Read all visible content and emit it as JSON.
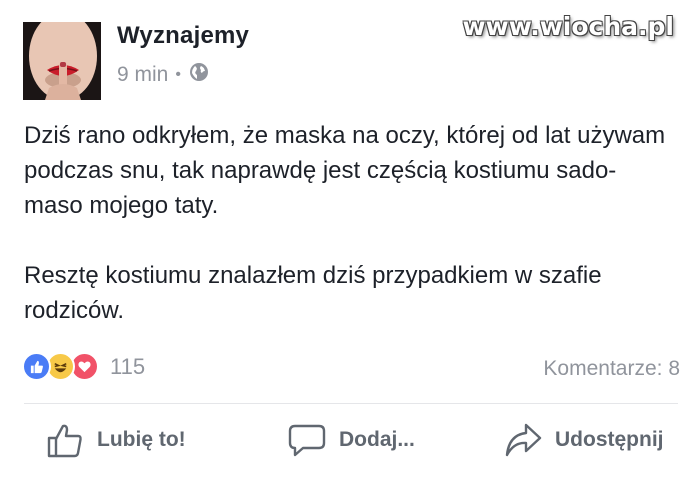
{
  "post": {
    "author": "Wyznajemy",
    "time": "9 min",
    "separator": "•",
    "privacy_icon": "globe-icon",
    "paragraphs": [
      "Dziś rano odkryłem, że maska na oczy, której od lat używam podczas snu, tak naprawdę jest częścią kostiumu sado-maso mojego taty.",
      "Resztę kostiumu znalazłem dziś przypadkiem w szafie rodziców."
    ],
    "reactions": [
      "like-icon",
      "haha-icon",
      "love-icon"
    ],
    "reaction_count": "115",
    "comments": "Komentarze: 8"
  },
  "actions": {
    "like": "Lubię to!",
    "comment": "Dodaj...",
    "share": "Udostępnij"
  },
  "watermark": "www.wiocha.pl",
  "colors": {
    "text": "#1d2129",
    "muted": "#90949c",
    "action": "#606770",
    "like": "#4a7cf6",
    "haha": "#f7c948",
    "love": "#f15268"
  }
}
